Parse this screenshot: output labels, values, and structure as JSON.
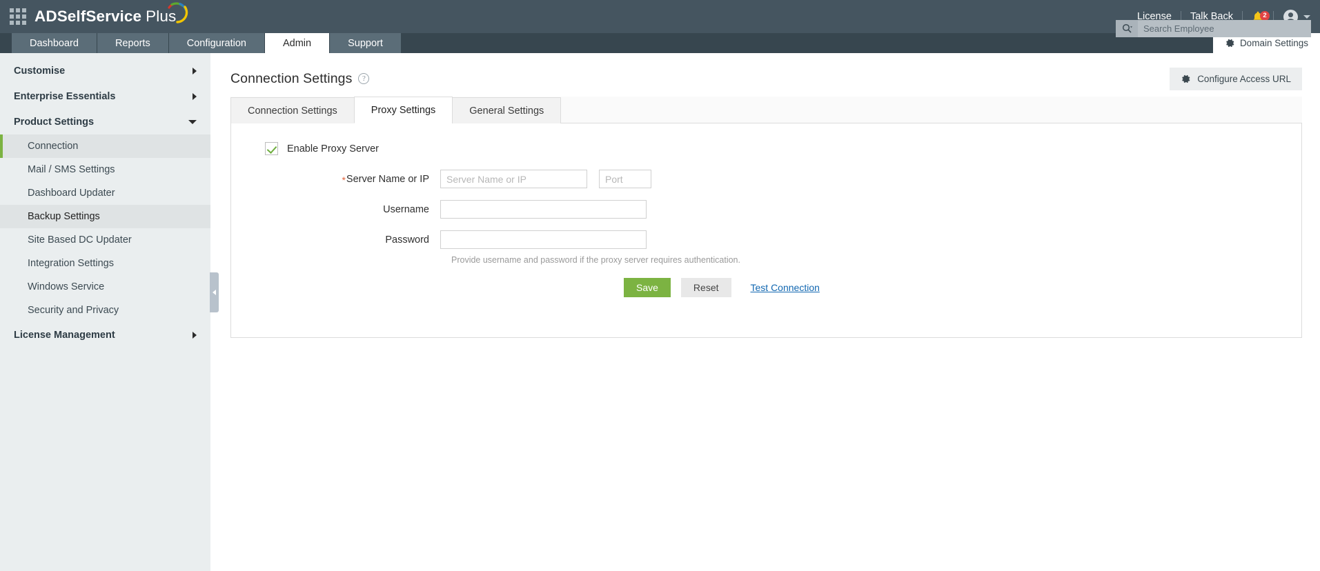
{
  "header": {
    "apps_icon": "grid-apps-icon",
    "brand_bold": "ADSelfService",
    "brand_light": "Plus",
    "links": [
      {
        "label": "License"
      },
      {
        "label": "Talk Back"
      }
    ],
    "notification_count": "2",
    "notification_icon": "bell-icon",
    "avatar_icon": "user-avatar-icon",
    "search": {
      "placeholder": "Search Employee",
      "value": "",
      "icon": "search-icon"
    }
  },
  "nav": {
    "tabs": [
      {
        "label": "Dashboard",
        "active": false
      },
      {
        "label": "Reports",
        "active": false
      },
      {
        "label": "Configuration",
        "active": false
      },
      {
        "label": "Admin",
        "active": true
      },
      {
        "label": "Support",
        "active": false
      }
    ],
    "domain_settings": {
      "label": "Domain Settings",
      "icon": "gear-icon"
    }
  },
  "sidebar": {
    "groups": [
      {
        "label": "Customise",
        "expanded": false
      },
      {
        "label": "Enterprise Essentials",
        "expanded": false
      },
      {
        "label": "Product Settings",
        "expanded": true
      }
    ],
    "items": [
      {
        "label": "Connection",
        "state": "active"
      },
      {
        "label": "Mail / SMS Settings",
        "state": "normal"
      },
      {
        "label": "Dashboard Updater",
        "state": "normal"
      },
      {
        "label": "Backup Settings",
        "state": "hover"
      },
      {
        "label": "Site Based DC Updater",
        "state": "normal"
      },
      {
        "label": "Integration Settings",
        "state": "normal"
      },
      {
        "label": "Windows Service",
        "state": "normal"
      },
      {
        "label": "Security and Privacy",
        "state": "normal"
      }
    ],
    "bottom_group": {
      "label": "License Management",
      "expanded": false
    },
    "collapse_handle": "collapse-sidebar-handle"
  },
  "page": {
    "title": "Connection Settings",
    "help_icon": "help-question-icon",
    "configure_access_url": {
      "label": "Configure Access URL",
      "icon": "gear-icon"
    }
  },
  "tabs": [
    {
      "label": "Connection Settings",
      "active": false
    },
    {
      "label": "Proxy Settings",
      "active": true
    },
    {
      "label": "General Settings",
      "active": false
    }
  ],
  "form": {
    "enable_proxy": {
      "label": "Enable Proxy Server",
      "checked": true
    },
    "server": {
      "label": "Server Name or IP",
      "required_marker": "*",
      "placeholder": "Server Name or IP",
      "value": ""
    },
    "port": {
      "placeholder": "Port",
      "value": ""
    },
    "username": {
      "label": "Username",
      "value": "",
      "placeholder": ""
    },
    "password": {
      "label": "Password",
      "value": "",
      "placeholder": ""
    },
    "hint": "Provide username and password if the proxy server requires authentication.",
    "buttons": {
      "save": "Save",
      "reset": "Reset",
      "test_connection": "Test Connection"
    }
  },
  "colors": {
    "topbar": "#455560",
    "navbar": "#37464f",
    "nav_tab": "#5b6d78",
    "sidebar": "#eaeeef",
    "accent_green": "#7cb342",
    "link_blue": "#1167b1",
    "badge_red": "#e04343",
    "required_orange": "#e2643a"
  }
}
